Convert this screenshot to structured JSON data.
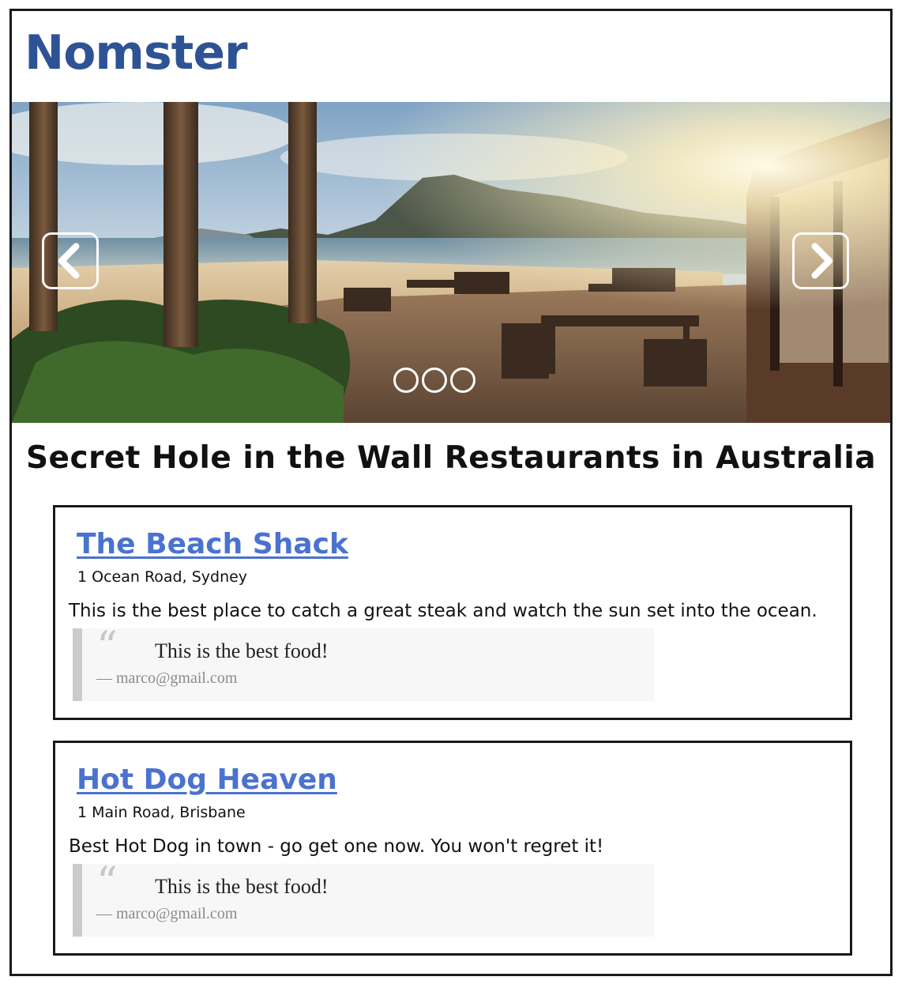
{
  "header": {
    "brand": "Nomster"
  },
  "carousel": {
    "slide_description": "beach restaurant patio at sunset",
    "prev_icon": "chevron-left-icon",
    "next_icon": "chevron-right-icon",
    "indicator_count": 3,
    "active_indicator": null
  },
  "main": {
    "heading": "Secret Hole in the Wall Restaurants in Australia",
    "places": [
      {
        "name": "The Beach Shack",
        "address": "1 Ocean Road, Sydney",
        "description": "This is the best place to catch a great steak and watch the sun set into the ocean.",
        "quote": {
          "text": "This is the best food!",
          "author": "— marco@gmail.com"
        }
      },
      {
        "name": "Hot Dog Heaven",
        "address": "1 Main Road, Brisbane",
        "description": "Best Hot Dog in town - go get one now. You won't regret it!",
        "quote": {
          "text": "This is the best food!",
          "author": "— marco@gmail.com"
        }
      }
    ]
  },
  "colors": {
    "brand": "#2e5394",
    "link": "#4a72cf",
    "border": "#1a1a1a",
    "quote_bar": "#cbcbcb",
    "quote_bg": "#f7f7f7"
  }
}
